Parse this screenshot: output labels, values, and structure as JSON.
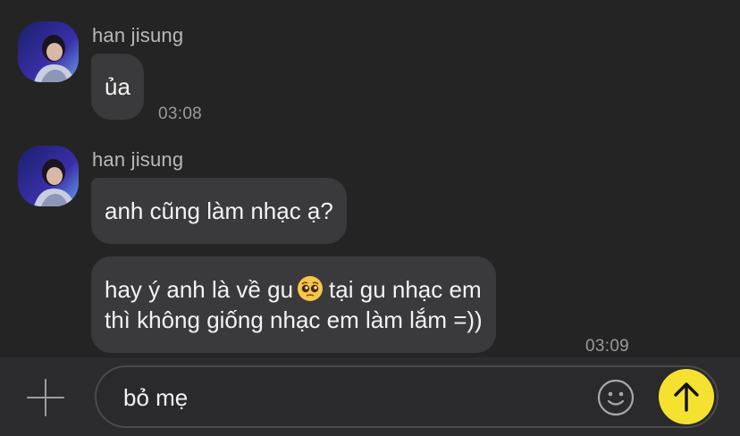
{
  "messages": [
    {
      "sender": "han jisung",
      "bubbles": [
        "ủa"
      ],
      "time": "03:08"
    },
    {
      "sender": "han jisung",
      "bubbles": [
        "anh cũng làm nhạc ạ?",
        {
          "line1_before": "hay ý anh là về gu",
          "line1_after": "tại gu nhạc em",
          "line2": "thì không giống nhạc em làm lắm =))"
        }
      ],
      "time": "03:09"
    }
  ],
  "composer": {
    "text": "bỏ mẹ",
    "icons": {
      "add": "plus-icon",
      "emoji": "smiley-icon",
      "send": "arrow-up-icon"
    },
    "send_color": "#f5e130"
  },
  "emoji": "pleading-face-emoji"
}
